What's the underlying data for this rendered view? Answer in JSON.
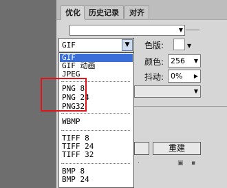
{
  "tabs": [
    "优化",
    "历史记录",
    "对齐"
  ],
  "format_select": {
    "value": "GIF"
  },
  "labels": {
    "matte": "色版:",
    "colors": "颜色:",
    "dither": "抖动:"
  },
  "fields": {
    "colors": "256",
    "dither": "0%"
  },
  "buttons": {
    "new": "重建"
  },
  "dropdown": {
    "options": [
      "GIF",
      "GIF 动画",
      "JPEG",
      "PNG 8",
      "PNG 24",
      "PNG32",
      "WBMP",
      "TIFF 8",
      "TIFF 24",
      "TIFF 32",
      "BMP 8",
      "BMP 24"
    ]
  },
  "colors": {
    "selection": "#3a6fd8",
    "highlight": "#e1131a"
  },
  "icons": [
    "chevron-down-icon",
    "menu-icon",
    "new-doc-icon",
    "trash-icon"
  ]
}
